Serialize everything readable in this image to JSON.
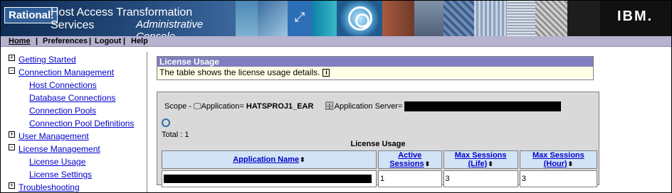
{
  "banner": {
    "brand": "Rational.",
    "title_line1": "Host Access Transformation Services",
    "title_line2": "Administrative Console",
    "vendor_logo": "IBM."
  },
  "menubar": {
    "items": [
      "Home",
      "Preferences",
      "Logout",
      "Help"
    ]
  },
  "nav": {
    "items": [
      {
        "label": "Getting Started",
        "toggle": "+"
      },
      {
        "label": "Connection Management",
        "toggle": "−"
      },
      {
        "label": "Host Connections"
      },
      {
        "label": "Database Connections"
      },
      {
        "label": "Connection Pools"
      },
      {
        "label": "Connection Pool Definitions"
      },
      {
        "label": "User Management",
        "toggle": "+"
      },
      {
        "label": "License Management",
        "toggle": "−"
      },
      {
        "label": "License Usage"
      },
      {
        "label": "License Settings"
      },
      {
        "label": "Troubleshooting",
        "toggle": "+"
      }
    ]
  },
  "license_usage": {
    "heading": "License Usage",
    "description": "The table shows the license usage details.",
    "info_icon": "i"
  },
  "scope": {
    "prefix": "Scope -",
    "application_label": "Application=",
    "application_value": "HATSPROJ1_EAR",
    "server_label": "Application Server="
  },
  "total_text": "Total : 1",
  "table": {
    "caption": "License Usage",
    "columns": [
      "Application Name",
      "Active Sessions",
      "Max Sessions (Life)",
      "Max Sessions (Hour)"
    ],
    "rows": [
      {
        "active": "1",
        "max_life": "3",
        "max_hour": "3"
      }
    ]
  }
}
